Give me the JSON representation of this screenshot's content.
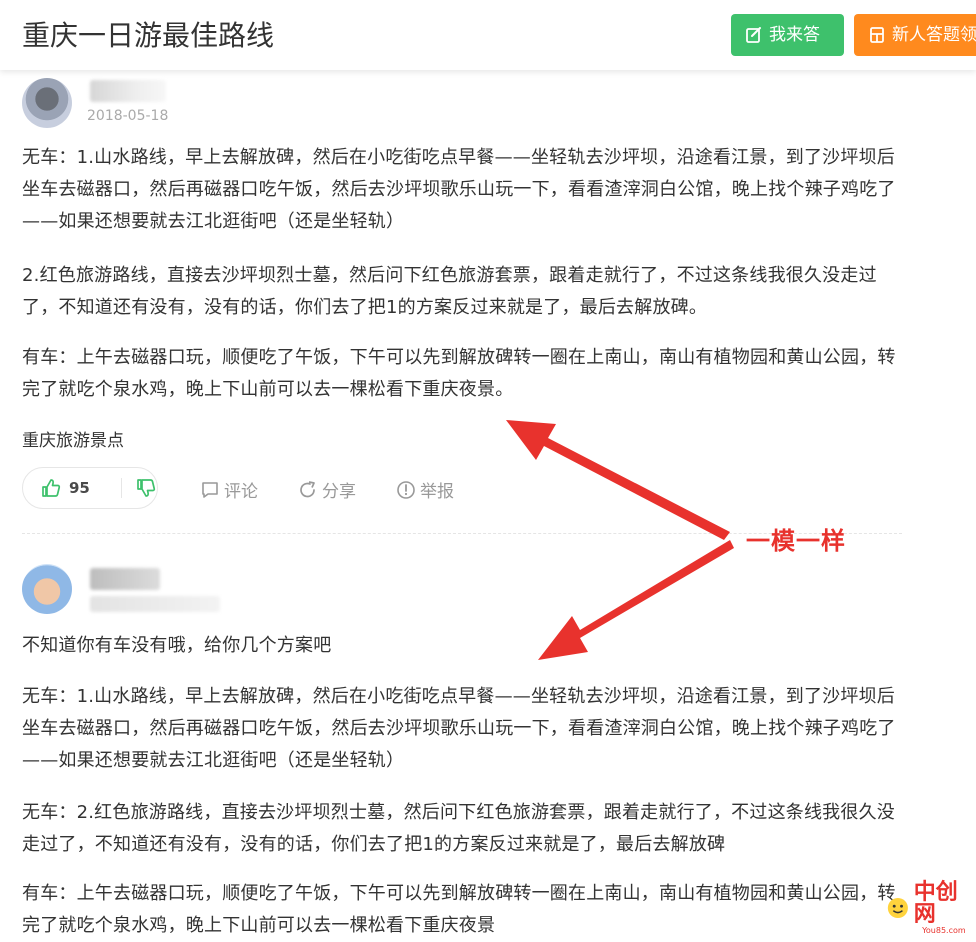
{
  "header": {
    "title": "重庆一日游最佳路线",
    "answer_button": "我来答",
    "newbie_button": "新人答题领"
  },
  "answers": [
    {
      "date": "2018-05-18",
      "paragraphs": [
        "无车：1.山水路线，早上去解放碑，然后在小吃街吃点早餐——坐轻轨去沙坪坝，沿途看江景，到了沙坪坝后坐车去磁器口，然后再磁器口吃午饭，然后去沙坪坝歌乐山玩一下，看看渣滓洞白公馆，晚上找个辣子鸡吃了——如果还想要就去江北逛街吧（还是坐轻轨）",
        "2.红色旅游路线，直接去沙坪坝烈士墓，然后问下红色旅游套票，跟着走就行了，不过这条线我很久没走过了，不知道还有没有，没有的话，你们去了把1的方案反过来就是了，最后去解放碑。",
        "有车：上午去磁器口玩，顺便吃了午饭，下午可以先到解放碑转一圈在上南山，南山有植物园和黄山公园，转完了就吃个泉水鸡，晚上下山前可以去一棵松看下重庆夜景。"
      ],
      "tag": "重庆旅游景点",
      "votes": "95",
      "actions": {
        "comment": "评论",
        "share": "分享",
        "report": "举报"
      }
    },
    {
      "intro": "不知道你有车没有哦，给你几个方案吧",
      "paragraphs": [
        "无车：1.山水路线，早上去解放碑，然后在小吃街吃点早餐——坐轻轨去沙坪坝，沿途看江景，到了沙坪坝后坐车去磁器口，然后再磁器口吃午饭，然后去沙坪坝歌乐山玩一下，看看渣滓洞白公馆，晚上找个辣子鸡吃了——如果还想要就去江北逛街吧（还是坐轻轨）",
        "无车：2.红色旅游路线，直接去沙坪坝烈士墓，然后问下红色旅游套票，跟着走就行了，不过这条线我很久没走过了，不知道还有没有，没有的话，你们去了把1的方案反过来就是了，最后去解放碑",
        "有车：上午去磁器口玩，顺便吃了午饭，下午可以先到解放碑转一圈在上南山，南山有植物园和黄山公园，转完了就吃个泉水鸡，晚上下山前可以去一棵松看下重庆夜景"
      ]
    }
  ],
  "annotation": {
    "text": "一模一样",
    "color": "#e8322d"
  },
  "watermark": {
    "name": "中创网",
    "domain": "You85.com"
  },
  "colors": {
    "answer_button": "#3ec16c",
    "newbie_button": "#ff8a1e",
    "accent_green": "#3ec16c"
  }
}
